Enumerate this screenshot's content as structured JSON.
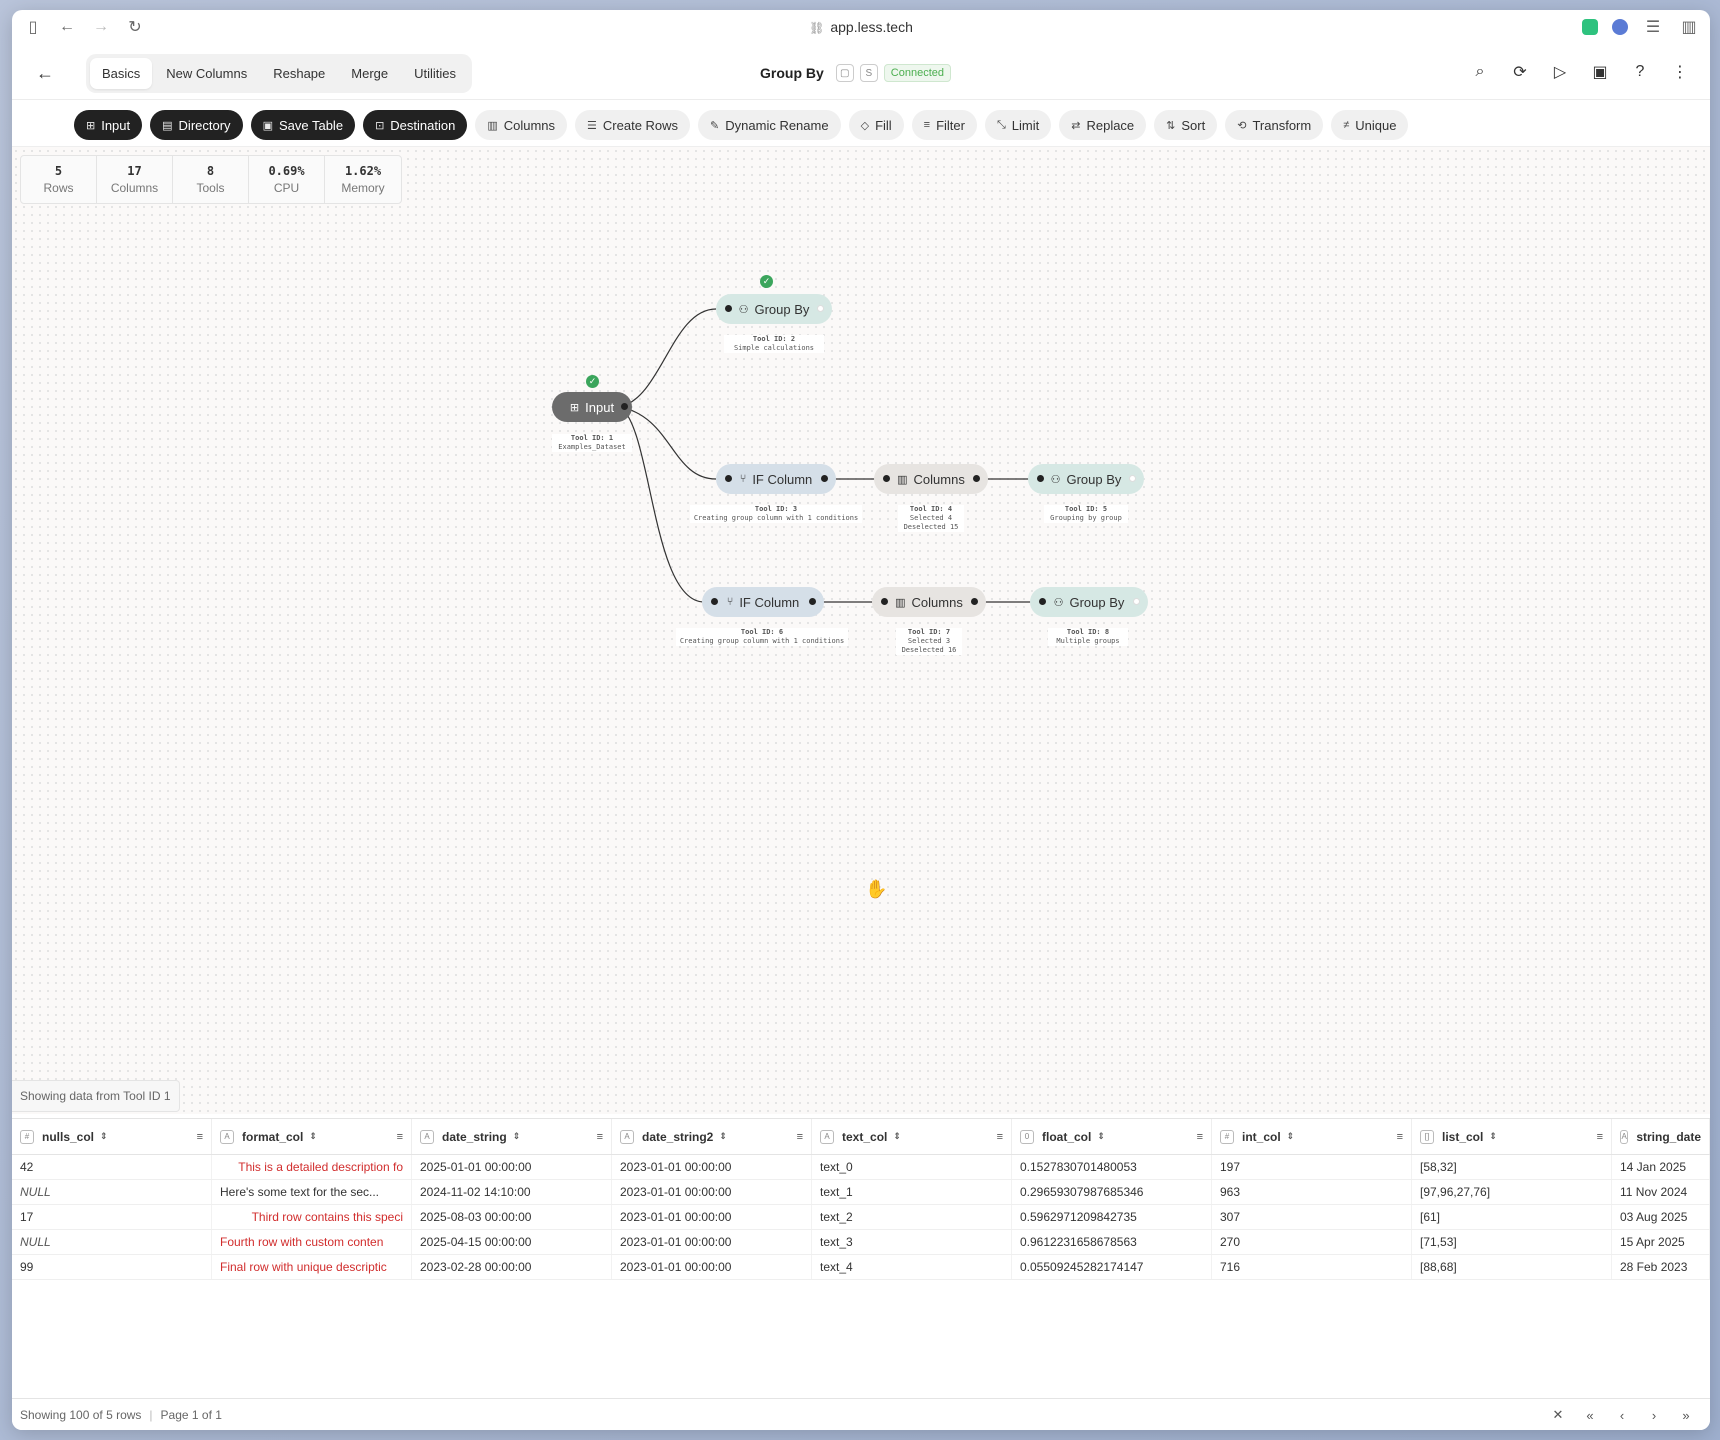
{
  "browser": {
    "url": "app.less.tech"
  },
  "header": {
    "tabs": [
      "Basics",
      "New Columns",
      "Reshape",
      "Merge",
      "Utilities"
    ],
    "active_tab": "Basics",
    "title": "Group By",
    "s_label": "S",
    "status": "Connected"
  },
  "toolbar": {
    "dark": [
      "Input",
      "Directory",
      "Save Table",
      "Destination"
    ],
    "light": [
      "Columns",
      "Create Rows",
      "Dynamic Rename",
      "Fill",
      "Filter",
      "Limit",
      "Replace",
      "Sort",
      "Transform",
      "Unique"
    ]
  },
  "stats": [
    {
      "value": "5",
      "label": "Rows"
    },
    {
      "value": "17",
      "label": "Columns"
    },
    {
      "value": "8",
      "label": "Tools"
    },
    {
      "value": "0.69%",
      "label": "CPU"
    },
    {
      "value": "1.62%",
      "label": "Memory"
    }
  ],
  "nodes": {
    "input": {
      "label": "Input",
      "meta_title": "Tool ID: 1",
      "meta_lines": [
        "Examples_Dataset"
      ]
    },
    "gb2": {
      "label": "Group By",
      "meta_title": "Tool ID: 2",
      "meta_lines": [
        "Simple calculations"
      ]
    },
    "if3": {
      "label": "IF Column",
      "meta_title": "Tool ID: 3",
      "meta_lines": [
        "Creating group column with 1 conditions"
      ]
    },
    "col4": {
      "label": "Columns",
      "meta_title": "Tool ID: 4",
      "meta_lines": [
        "Selected 4",
        "Deselected 15"
      ]
    },
    "gb5": {
      "label": "Group By",
      "meta_title": "Tool ID: 5",
      "meta_lines": [
        "Grouping by group"
      ]
    },
    "if6": {
      "label": "IF Column",
      "meta_title": "Tool ID: 6",
      "meta_lines": [
        "Creating group column with 1 conditions"
      ]
    },
    "col7": {
      "label": "Columns",
      "meta_title": "Tool ID: 7",
      "meta_lines": [
        "Selected 3",
        "Deselected 16"
      ]
    },
    "gb8": {
      "label": "Group By",
      "meta_title": "Tool ID: 8",
      "meta_lines": [
        "Multiple groups"
      ]
    }
  },
  "data_panel": {
    "showing_label": "Showing data from Tool ID 1",
    "columns": [
      "nulls_col",
      "format_col",
      "date_string",
      "date_string2",
      "text_col",
      "float_col",
      "int_col",
      "list_col",
      "string_date"
    ],
    "rows": [
      [
        "42",
        "This is a detailed description fo",
        "2025-01-01 00:00:00",
        "2023-01-01 00:00:00",
        "text_0",
        "0.1527830701480053",
        "197",
        "[58,32]",
        "14 Jan 2025"
      ],
      [
        "NULL",
        "Here's some text for the sec...",
        "2024-11-02 14:10:00",
        "2023-01-01 00:00:00",
        "text_1",
        "0.29659307987685346",
        "963",
        "[97,96,27,76]",
        "11 Nov 2024"
      ],
      [
        "17",
        "Third row contains this speci",
        "2025-08-03 00:00:00",
        "2023-01-01 00:00:00",
        "text_2",
        "0.5962971209842735",
        "307",
        "[61]",
        "03 Aug 2025"
      ],
      [
        "NULL",
        "Fourth row with custom conten",
        "2025-04-15 00:00:00",
        "2023-01-01 00:00:00",
        "text_3",
        "0.9612231658678563",
        "270",
        "[71,53]",
        "15 Apr 2025"
      ],
      [
        "99",
        "Final row with unique descriptic",
        "2023-02-28 00:00:00",
        "2023-01-01 00:00:00",
        "text_4",
        "0.05509245282174147",
        "716",
        "[88,68]",
        "28 Feb 2023"
      ]
    ],
    "format_col_styles": [
      "red-right",
      "plain",
      "red-right",
      "red",
      "red"
    ],
    "footer_rows": "Showing 100 of 5 rows",
    "footer_page": "Page 1 of 1"
  },
  "colors": {
    "success": "#3ba55c",
    "error_text": "#d12d2d",
    "dark_button": "#222222"
  }
}
